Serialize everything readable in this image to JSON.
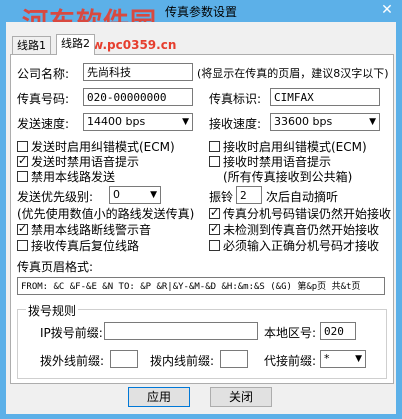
{
  "window": {
    "title": "传真参数设置",
    "close_glyph": "✕"
  },
  "watermark": {
    "text": "河东软件园",
    "url": "www.pc0359.cn"
  },
  "tabs": [
    "线路1",
    "线路2"
  ],
  "fields": {
    "company_label": "公司名称:",
    "company_value": "先尚科技",
    "company_hint": "(将显示在传真的页眉，建议8汉字以下)",
    "fax_number_label": "传真号码:",
    "fax_number_value": "020-00000000",
    "fax_id_label": "传真标识:",
    "fax_id_value": "CIMFAX",
    "send_speed_label": "发送速度:",
    "send_speed_value": "14400 bps",
    "recv_speed_label": "接收速度:",
    "recv_speed_value": "33600 bps",
    "priority_label": "发送优先级别:",
    "priority_value": "0",
    "priority_hint": "(优先使用数值小的路线发送传真)",
    "ring_label": "振铃",
    "ring_value": "2",
    "ring_suffix": "次后自动摘听",
    "header_format_label": "传真页眉格式:",
    "header_format_value": "FROM: &C &F-&E &N     TO: &P &R|&Y-&M-&D &H:&m:&S (&G) 第&p页 共&t页"
  },
  "checkboxes_left": [
    {
      "label": "发送时启用纠错模式(ECM)",
      "checked": false
    },
    {
      "label": "发送时禁用语音提示",
      "checked": true
    },
    {
      "label": "禁用本线路发送",
      "checked": false
    },
    {
      "label": "禁用本线路断线警示音",
      "checked": true
    },
    {
      "label": "接收传真后复位线路",
      "checked": false
    }
  ],
  "checkboxes_right": [
    {
      "label": "接收时启用纠错模式(ECM)",
      "checked": false
    },
    {
      "label": "接收时禁用语音提示",
      "checked": false
    },
    {
      "label": "(所有传真接收到公共箱)",
      "checked": false
    },
    {
      "label": "传真分机号码错误仍然开始接收",
      "checked": true
    },
    {
      "label": "未检测到传真音仍然开始接收",
      "checked": true
    },
    {
      "label": "必须输入正确分机号码才接收",
      "checked": false
    }
  ],
  "dial_rules": {
    "title": "拨号规则",
    "ip_prefix_label": "IP拨号前缀:",
    "ip_prefix_value": "",
    "area_code_label": "本地区号:",
    "area_code_value": "020",
    "outside_prefix_label": "拨外线前缀:",
    "outside_prefix_value": "",
    "inside_prefix_label": "拨内线前缀:",
    "inside_prefix_value": "",
    "replace_prefix_label": "代接前缀:",
    "replace_prefix_value": "*"
  },
  "buttons": {
    "apply": "应用",
    "close": "关闭"
  }
}
